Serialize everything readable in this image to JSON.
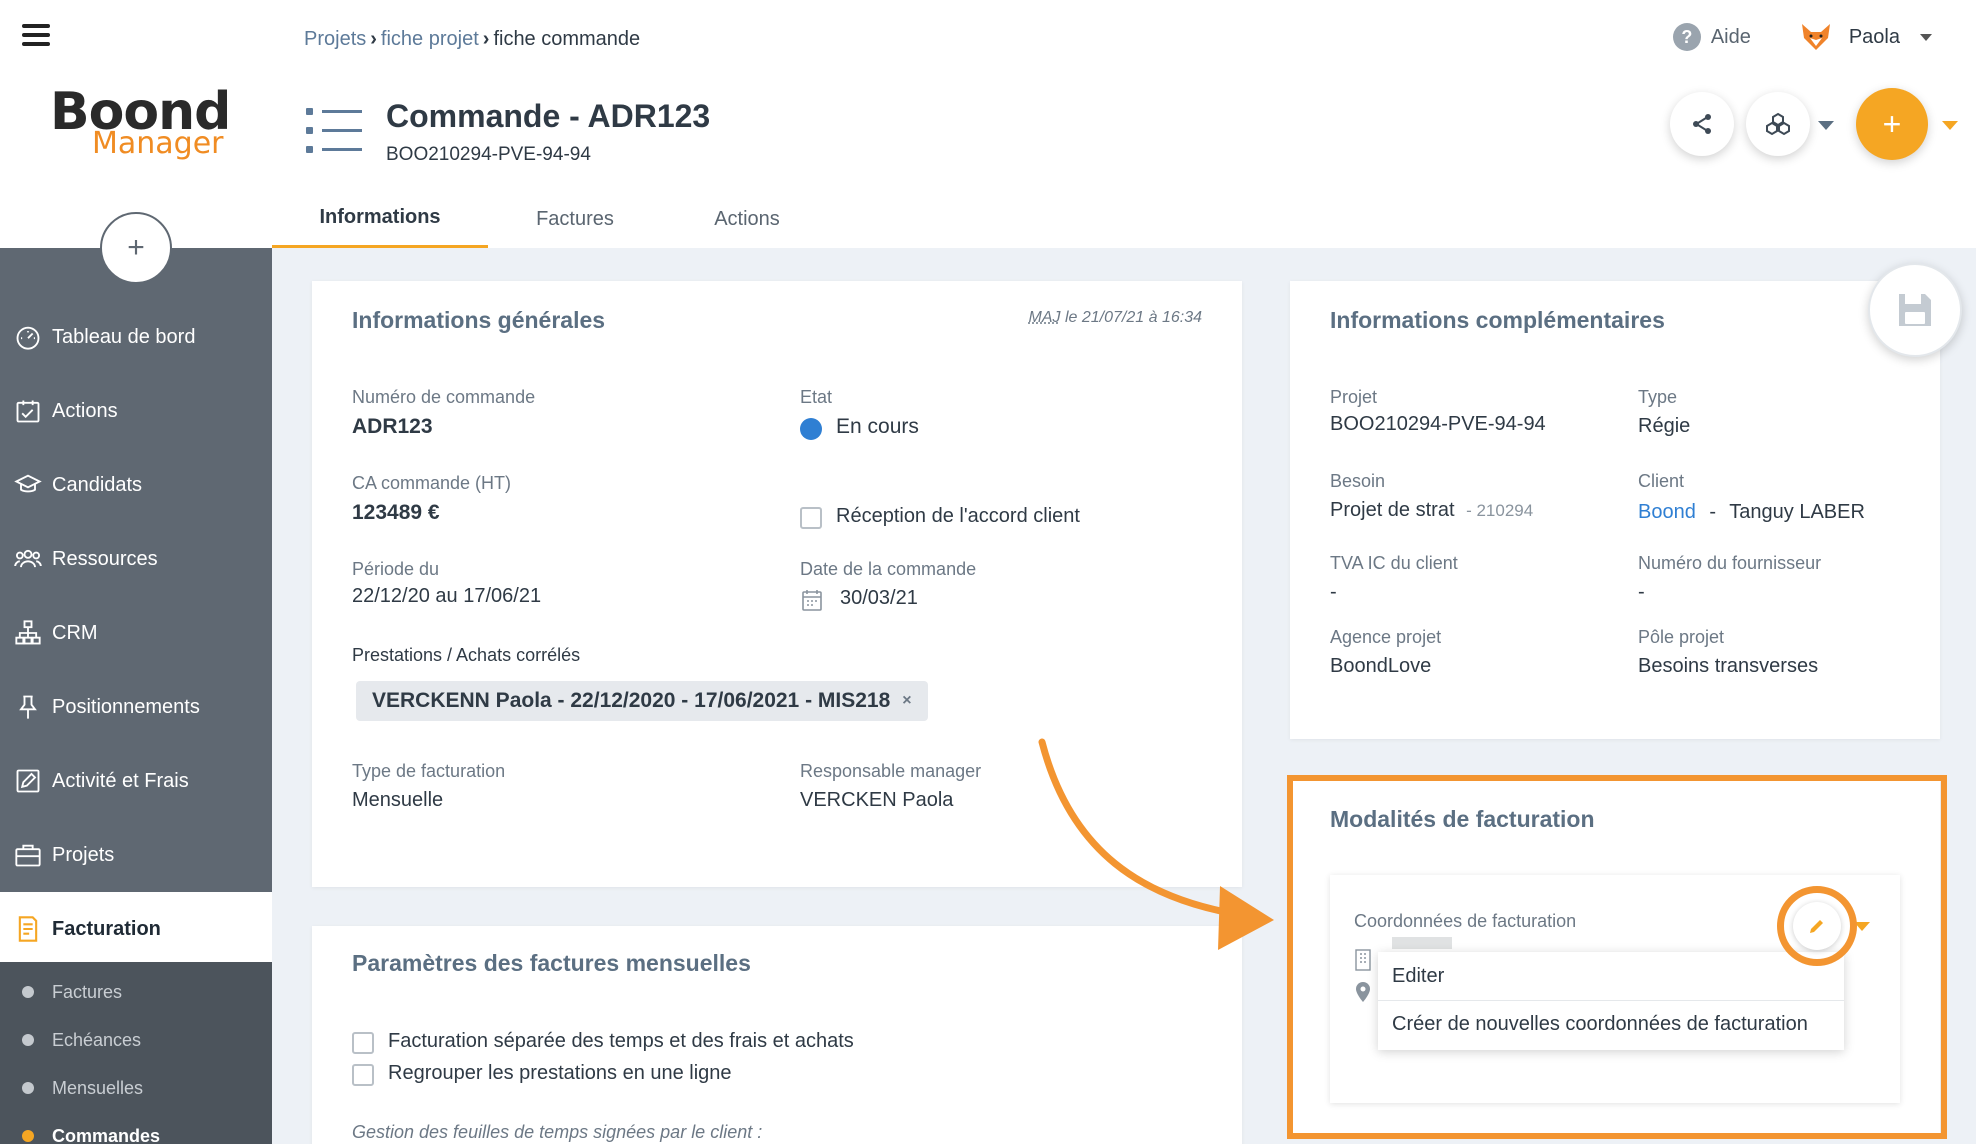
{
  "sidebar": {
    "items": [
      {
        "label": "Tableau de bord"
      },
      {
        "label": "Actions"
      },
      {
        "label": "Candidats"
      },
      {
        "label": "Ressources"
      },
      {
        "label": "CRM"
      },
      {
        "label": "Positionnements"
      },
      {
        "label": "Activité et Frais"
      },
      {
        "label": "Projets"
      },
      {
        "label": "Facturation"
      }
    ],
    "subitems": [
      {
        "label": "Factures"
      },
      {
        "label": "Echéances"
      },
      {
        "label": "Mensuelles"
      },
      {
        "label": "Commandes"
      }
    ],
    "add_symbol": "+",
    "logo_main": "Boond",
    "logo_sub": "Manager"
  },
  "header": {
    "breadcrumb": [
      "Projets",
      "fiche projet",
      "fiche commande"
    ],
    "help_label": "Aide",
    "user_name": "Paola",
    "title": "Commande - ADR123",
    "subtitle": "BOO210294-PVE-94-94",
    "tabs": [
      {
        "label": "Informations"
      },
      {
        "label": "Factures"
      },
      {
        "label": "Actions"
      }
    ],
    "add_symbol": "+"
  },
  "general": {
    "title": "Informations générales",
    "maj_abbr": "MAJ",
    "maj_text": "le 21/07/21 à 16:34",
    "order_number_label": "Numéro de commande",
    "order_number": "ADR123",
    "state_label": "Etat",
    "state": "En cours",
    "state_color": "#2f7fd3",
    "ca_label": "CA commande (HT)",
    "ca": "123489 €",
    "accord_label": "Réception de l'accord client",
    "period_label": "Période du",
    "period": "22/12/20 au 17/06/21",
    "date_label": "Date de la commande",
    "date": "30/03/21",
    "prestations_label": "Prestations / Achats corrélés",
    "prestation_chip": "VERCKENN Paola - 22/12/2020 - 17/06/2021 - MIS218",
    "chip_remove": "×",
    "billing_type_label": "Type de facturation",
    "billing_type": "Mensuelle",
    "manager_label": "Responsable manager",
    "manager": "VERCKEN Paola"
  },
  "monthly": {
    "title": "Paramètres des factures mensuelles",
    "opt1": "Facturation séparée des temps et des frais et achats",
    "opt2": "Regrouper les prestations en une ligne",
    "note": "Gestion des feuilles de temps signées par le client :"
  },
  "complementary": {
    "title": "Informations complémentaires",
    "project_label": "Projet",
    "project": "BOO210294-PVE-94-94",
    "type_label": "Type",
    "type": "Régie",
    "need_label": "Besoin",
    "need": "Projet de strat",
    "need_ref": "- 210294",
    "client_label": "Client",
    "client_company": "Boond",
    "client_sep": "-",
    "client_contact": "Tanguy LABER",
    "vat_label": "TVA IC du client",
    "vat": "-",
    "supplier_label": "Numéro du fournisseur",
    "supplier": "-",
    "agency_label": "Agence projet",
    "agency": "BoondLove",
    "pole_label": "Pôle projet",
    "pole": "Besoins transverses"
  },
  "billing": {
    "title": "Modalités de facturation",
    "coords_label": "Coordonnées de facturation",
    "menu": [
      {
        "label": "Editer"
      },
      {
        "label": "Créer de nouvelles coordonnées de facturation"
      }
    ]
  },
  "colors": {
    "accent": "#f5a623",
    "highlight": "#f39531",
    "link": "#2f7fd3"
  }
}
